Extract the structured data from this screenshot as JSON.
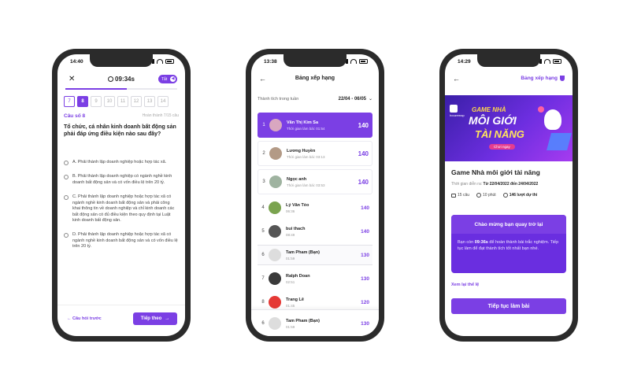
{
  "colors": {
    "accent": "#7b3fe4",
    "accent_light": "#efe6ff"
  },
  "quiz": {
    "status_time": "14:40",
    "timer": "09:34s",
    "audio_toggle": "Tắt",
    "progress": 0.55,
    "question_numbers": [
      "7",
      "8",
      "9",
      "10",
      "11",
      "12",
      "13",
      "14"
    ],
    "current_index": 1,
    "question_label": "Câu số 8",
    "completed_text": "Hoàn thành 7/15 câu",
    "question": "Tổ chức, cá nhân kinh doanh bất động sản phải đáp ứng điều kiện nào sau đây?",
    "options": [
      "A. Phải thành lập doanh nghiệp hoặc hợp tác xã.",
      "B. Phải thành lập doanh nghiệp có ngành nghề kinh doanh bất động sản và có vốn điều lệ trên 20 tỷ.",
      "C. Phải thành lập doanh nghiệp hoặc hợp tác xã có ngành nghề kinh doanh bất động sản và phải công khai thông tin về doanh nghiệp và chỉ kinh doanh các bất động sản có đủ điều kiện theo quy định tại Luật kinh doanh bất động sản.",
      "D. Phải thành lập doanh nghiệp hoặc hợp tác xã có ngành nghề kinh doanh bất động sản và có vốn điều lệ trên 20 tỷ."
    ],
    "prev_label": "Câu hỏi trước",
    "next_label": "Tiếp theo"
  },
  "leaderboard": {
    "status_time": "13:38",
    "title": "Bảng xếp hạng",
    "filter_label": "Thành tích trong tuần",
    "range": "22/04 - 06/05",
    "rows": [
      {
        "rank": "1",
        "name": "Văn Thị Kim Sa",
        "sub": "Thời gian làm bài: 01:54",
        "score": "140",
        "avatar": "#d9a7c0"
      },
      {
        "rank": "2",
        "name": "Lương Huyền",
        "sub": "Thời gian làm bài: 03:13",
        "score": "140",
        "avatar": "#b39a86"
      },
      {
        "rank": "3",
        "name": "Ngọc anh",
        "sub": "Thời gian làm bài: 03:53",
        "score": "140",
        "avatar": "#9fb3a0"
      },
      {
        "rank": "4",
        "name": "Lý Văn Tèo",
        "sub": "06:36",
        "score": "140",
        "avatar": "#7aa34f"
      },
      {
        "rank": "5",
        "name": "bui thach",
        "sub": "08:49",
        "score": "140",
        "avatar": "#555555"
      },
      {
        "rank": "6",
        "name": "Tam Pham (Bạn)",
        "sub": "01:59",
        "score": "130",
        "avatar": "#dddddd"
      },
      {
        "rank": "7",
        "name": "Ralph Doan",
        "sub": "02:51",
        "score": "130",
        "avatar": "#3a3a3a"
      },
      {
        "rank": "8",
        "name": "Trang Lê",
        "sub": "01:45",
        "score": "120",
        "avatar": "#e53935"
      }
    ],
    "me": {
      "rank": "6",
      "name": "Tam Pham (Bạn)",
      "sub": "01:59",
      "score": "130",
      "avatar": "#dddddd"
    }
  },
  "game": {
    "status_time": "14:29",
    "leaderboard_link": "Bảng xếp hạng",
    "banner_logo": "houzemap",
    "banner_line1": "GAME NHÀ",
    "banner_line2": "MÔI GIỚI",
    "banner_line3": "TÀI NĂNG",
    "banner_play": "Chơi ngay",
    "title": "Game Nhà môi giới tài năng",
    "date_label": "Thời gian diễn ra:",
    "date_value": "Từ 22/04/2022 đến 24/04/2022",
    "stat_questions": "15 câu",
    "stat_minutes": "10 phút",
    "stat_plays": "146 lượt dự thi",
    "welcome_title": "Chào mừng bạn quay trở lại",
    "welcome_pre": "Bạn còn ",
    "welcome_time": "09:36s",
    "welcome_post": " để hoàn thành bài trắc nghiệm. Tiếp tục làm để đạt thành tích tốt nhất bạn nhé.",
    "rules_link": "Xem lại thể lệ",
    "continue_label": "Tiếp tục làm bài"
  }
}
